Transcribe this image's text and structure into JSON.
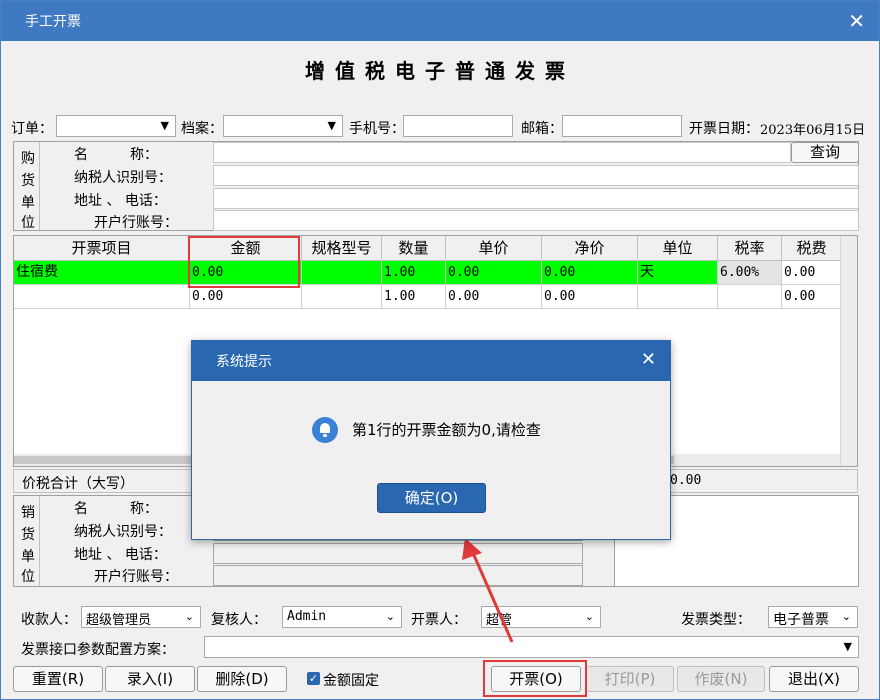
{
  "window": {
    "title": "手工开票",
    "close_glyph": "✕"
  },
  "invoice_heading": "增值税电子普通发票",
  "top_fields": {
    "order_label": "订单：",
    "archive_label": "档案：",
    "phone_label": "手机号：",
    "email_label": "邮箱：",
    "date_label": "开票日期：",
    "date_value": "2023年06月15日"
  },
  "buyer": {
    "side_chars": [
      "购",
      "货",
      "单",
      "位"
    ],
    "name_label": "名　　　称：",
    "taxid_label": "纳税人识别号：",
    "address_label": "地址 、 电话：",
    "bank_label": "开户行账号：",
    "query_button": "查询"
  },
  "grid": {
    "headers": [
      "开票项目",
      "金额",
      "规格型号",
      "数量",
      "单价",
      "净价",
      "单位",
      "税率",
      "税费"
    ],
    "rows": [
      [
        "住宿费",
        "0.00",
        "",
        "1.00",
        "0.00",
        "0.00",
        "天",
        "6.00%",
        "0.00"
      ],
      [
        "",
        "0.00",
        "",
        "1.00",
        "0.00",
        "0.00",
        "",
        "",
        "0.00"
      ]
    ]
  },
  "summary": {
    "label": "价税合计（大写）",
    "value": "0.00"
  },
  "seller": {
    "side_chars": [
      "销",
      "货",
      "单",
      "位"
    ],
    "name_label": "名　　　称：",
    "taxid_label": "纳税人识别号：",
    "address_label": "地址 、 电话：",
    "bank_label": "开户行账号："
  },
  "people": {
    "payee_label": "收款人：",
    "payee_value": "超级管理员",
    "reviewer_label": "复核人：",
    "reviewer_value": "Admin",
    "drawer_label": "开票人：",
    "drawer_value": "超管",
    "type_label": "发票类型：",
    "type_value": "电子普票"
  },
  "config": {
    "label": "发票接口参数配置方案："
  },
  "buttons": {
    "reset": "重置(R)",
    "entry": "录入(I)",
    "delete": "删除(D)",
    "fixed_amount": "金额固定",
    "issue": "开票(O)",
    "print": "打印(P)",
    "void": "作废(N)",
    "exit": "退出(X)"
  },
  "dialog": {
    "title": "系统提示",
    "message": "第1行的开票金额为0,请检查",
    "ok": "确定(O)"
  },
  "colors": {
    "titlebar": "#3e79c2",
    "highlight_row": "#00ff00",
    "annotation": "#e03a3a"
  }
}
